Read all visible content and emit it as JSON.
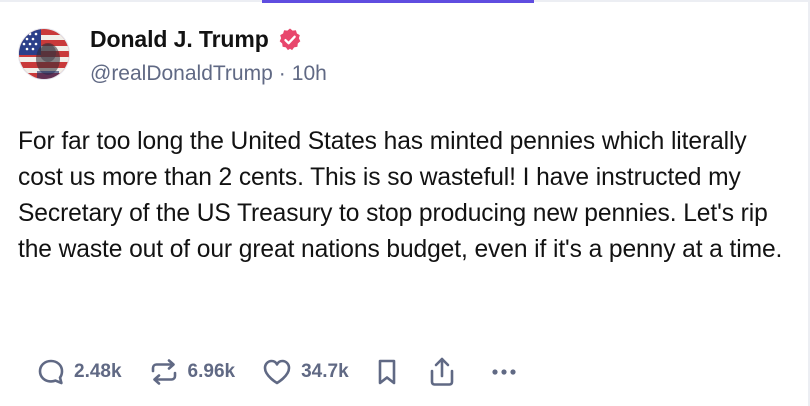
{
  "post": {
    "author": {
      "display_name": "Donald J. Trump",
      "handle": "@realDonaldTrump",
      "separator": "·",
      "time": "10h",
      "verified": true,
      "avatar": "flag-portrait-avatar"
    },
    "content": "For far too long the United States has minted pennies which literally cost us more than 2 cents. This is so wasteful! I have instructed my Secretary of the US Treasury to stop producing new pennies. Let's rip the waste out of our great nations budget, even if it's a penny at a time.",
    "actions": {
      "replies": "2.48k",
      "reposts": "6.96k",
      "likes": "34.7k"
    }
  },
  "colors": {
    "accent": "#5f4de0",
    "verified_badge": "#e8466c",
    "muted_text": "#606984",
    "body_text": "#121212"
  },
  "icons": {
    "reply": "reply-icon",
    "repost": "repost-icon",
    "like": "heart-icon",
    "bookmark": "bookmark-icon",
    "share": "share-icon",
    "more": "more-icon",
    "verified": "verified-badge-icon"
  }
}
